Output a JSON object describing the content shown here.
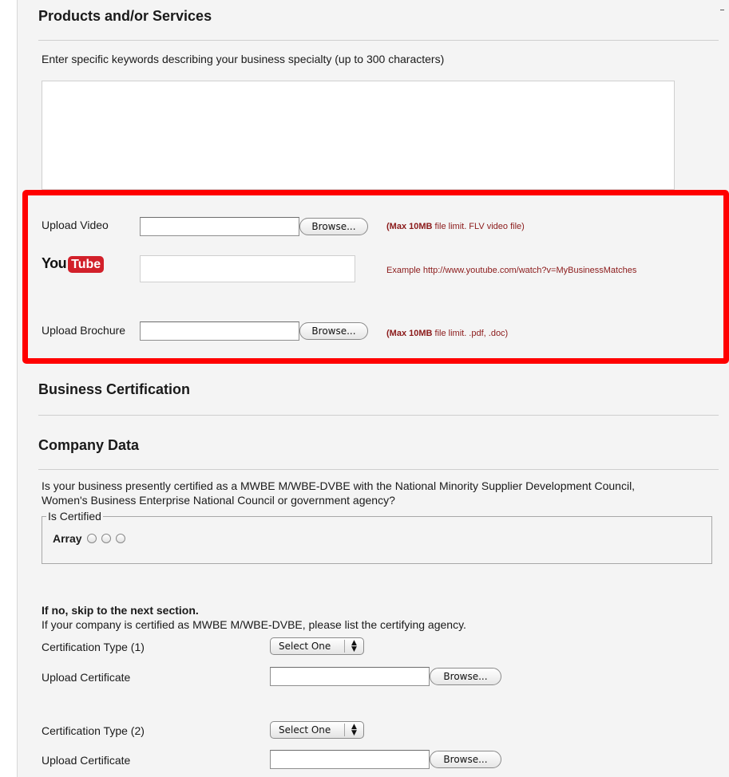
{
  "products_section": {
    "title": "Products and/or Services",
    "keywords_prompt": "Enter specific keywords describing your business specialty (up to 300 characters)",
    "keywords_value": ""
  },
  "uploads": {
    "video_label": "Upload Video",
    "video_browse": "Browse...",
    "video_note_bold": "(Max 10MB",
    "video_note_rest": " file limit. FLV video file)",
    "youtube_logo_you": "You",
    "youtube_logo_tube": "Tube",
    "youtube_value": "",
    "youtube_example": "Example http://www.youtube.com/watch?v=MyBusinessMatches",
    "brochure_label": "Upload Brochure",
    "brochure_browse": "Browse...",
    "brochure_note_bold": "(Max 10MB",
    "brochure_note_rest": " file limit. .pdf, .doc)",
    "highlight_color": "#ff0000"
  },
  "business_certification": {
    "title": "Business Certification"
  },
  "company_data": {
    "title": "Company Data",
    "question_line1": "Is your business presently certified as a MWBE M/WBE-DVBE with the National Minority Supplier Development Council,",
    "question_line2": "Women's Business Enterprise National Council or government agency?",
    "fieldset_legend": "Is Certified",
    "radio_group_label": "Array",
    "skip_note": "If no, skip to the next section.",
    "list_prompt": "If your company is certified as MWBE M/WBE-DVBE, please list the certifying agency.",
    "cert_type_1_label": "Certification Type (1)",
    "cert_type_1_value": "Select One",
    "upload_cert_1_label": "Upload Certificate",
    "upload_cert_1_browse": "Browse...",
    "cert_type_2_label": "Certification Type (2)",
    "cert_type_2_value": "Select One",
    "upload_cert_2_label": "Upload Certificate",
    "upload_cert_2_browse": "Browse..."
  }
}
